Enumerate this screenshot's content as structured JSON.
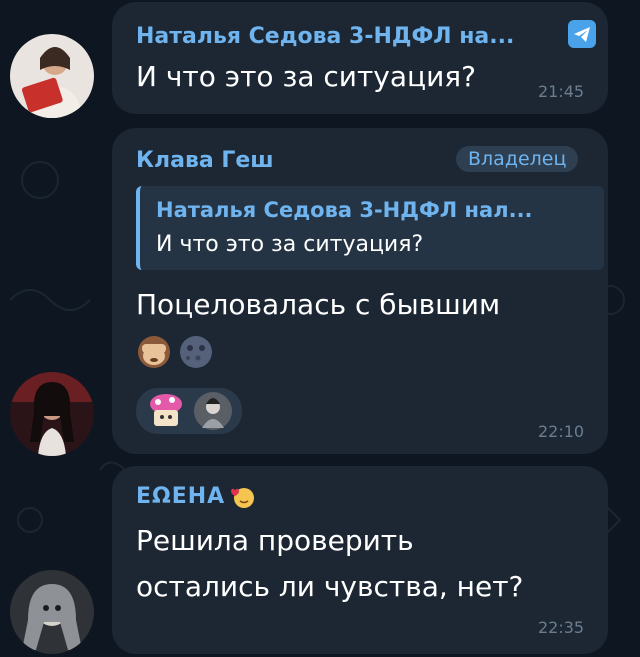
{
  "messages": [
    {
      "sender": "Наталья Седова 3-НДФЛ на...",
      "text": "И что это за ситуация?",
      "time": "21:45"
    },
    {
      "sender": "Клава Геш",
      "badge": "Владелец",
      "reply_sender": "Наталья Седова 3-НДФЛ нал...",
      "reply_text": "И что это за ситуация?",
      "text": "Поцеловалась с бывшим",
      "time": "22:10"
    },
    {
      "sender": "ЕΩЕНА",
      "text_line1": "Решила проверить",
      "text_line2": "остались ли чувства, нет?",
      "time": "22:35"
    }
  ],
  "icons": {
    "telegram_badge": "telegram-icon",
    "see_no_evil": "see-no-evil-monkey",
    "new_moon_face": "new-moon-face",
    "reaction_cake": "cake-sticker",
    "reaction_avatar": "user-avatar",
    "heart_eyes": "heart-face"
  },
  "colors": {
    "background": "#0e1621",
    "bubble": "#1c2733",
    "name_accent": "#6fb4ef",
    "time": "#6b7d8f"
  }
}
